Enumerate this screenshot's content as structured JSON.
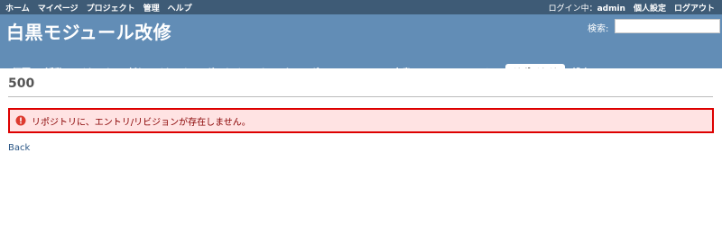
{
  "top_menu": {
    "left_items": [
      "ホーム",
      "マイページ",
      "プロジェクト",
      "管理",
      "ヘルプ"
    ],
    "logged_in_label": "ログイン中：",
    "username": "admin",
    "right_items": [
      "個人設定",
      "ログアウト"
    ]
  },
  "header": {
    "project_title": "白黒モジュール改修",
    "search_label": "検索:",
    "search_value": ""
  },
  "main_menu": {
    "tabs": [
      "概要",
      "活動",
      "チケット",
      "新しいチケット",
      "ガントチャート",
      "カレンダー",
      "ニュース",
      "文書",
      "Wiki",
      "ファイル",
      "リポジトリ",
      "設定"
    ],
    "selected": "リポジトリ"
  },
  "content": {
    "heading": "500",
    "error_message": "リポジトリに、エントリ/リビジョンが存在しません。",
    "back_link": "Back"
  },
  "colors": {
    "top_menu_bg": "#3e5b76",
    "header_bg": "#628db6",
    "error_bg": "#ffe3e3",
    "error_border": "#dd0000",
    "link": "#2a5685"
  }
}
